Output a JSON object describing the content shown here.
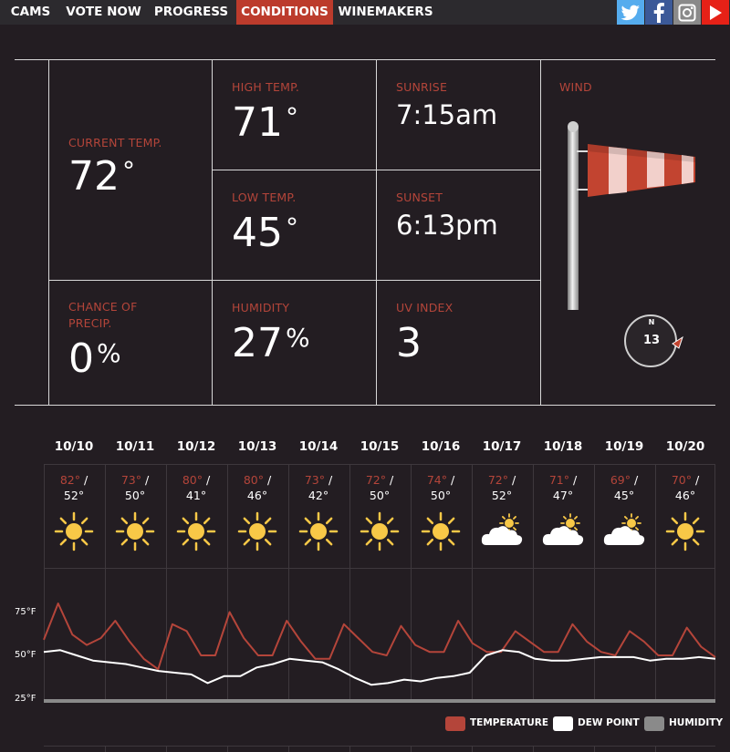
{
  "nav": {
    "items": [
      "CAMS",
      "VOTE NOW",
      "PROGRESS",
      "CONDITIONS",
      "WINEMAKERS"
    ],
    "active": "CONDITIONS",
    "social_icons": [
      "twitter-icon",
      "facebook-icon",
      "instagram-icon",
      "youtube-icon"
    ],
    "social_colors": [
      "#55acee",
      "#3b5998",
      "#8a8a8a",
      "#e62117"
    ]
  },
  "conditions": {
    "current_temp": {
      "label": "CURRENT TEMP.",
      "value": "72",
      "unit": "°"
    },
    "high_temp": {
      "label": "HIGH TEMP.",
      "value": "71",
      "unit": "°"
    },
    "low_temp": {
      "label": "LOW TEMP.",
      "value": "45",
      "unit": "°"
    },
    "sunrise": {
      "label": "SUNRISE",
      "value": "7:15am"
    },
    "sunset": {
      "label": "SUNSET",
      "value": "6:13pm"
    },
    "precip": {
      "label": "CHANCE OF PRECIP.",
      "value": "0",
      "unit": "%"
    },
    "humidity": {
      "label": "HUMIDITY",
      "value": "27",
      "unit": "%"
    },
    "uv_index": {
      "label": "UV INDEX",
      "value": "3"
    },
    "wind": {
      "label": "WIND",
      "speed": "13",
      "direction_label": "N"
    }
  },
  "forecast": [
    {
      "date": "10/10",
      "high": "82°",
      "low": "52°",
      "icon": "sun-icon"
    },
    {
      "date": "10/11",
      "high": "73°",
      "low": "50°",
      "icon": "sun-icon"
    },
    {
      "date": "10/12",
      "high": "80°",
      "low": "41°",
      "icon": "sun-icon"
    },
    {
      "date": "10/13",
      "high": "80°",
      "low": "46°",
      "icon": "sun-icon"
    },
    {
      "date": "10/14",
      "high": "73°",
      "low": "42°",
      "icon": "sun-icon"
    },
    {
      "date": "10/15",
      "high": "72°",
      "low": "50°",
      "icon": "sun-icon"
    },
    {
      "date": "10/16",
      "high": "74°",
      "low": "50°",
      "icon": "sun-icon"
    },
    {
      "date": "10/17",
      "high": "72°",
      "low": "52°",
      "icon": "partly-cloudy-icon"
    },
    {
      "date": "10/18",
      "high": "71°",
      "low": "47°",
      "icon": "partly-cloudy-icon"
    },
    {
      "date": "10/19",
      "high": "69°",
      "low": "45°",
      "icon": "partly-cloudy-icon"
    },
    {
      "date": "10/20",
      "high": "70°",
      "low": "46°",
      "icon": "sun-icon"
    }
  ],
  "chart_data": {
    "type": "line",
    "title": "",
    "xlabel": "",
    "ylabel": "",
    "y_ticks": [
      "75°F",
      "50°F",
      "25°F"
    ],
    "ylim": [
      25,
      85
    ],
    "x_categories": [
      "10/10",
      "10/11",
      "10/12",
      "10/13",
      "10/14",
      "10/15",
      "10/16",
      "10/17",
      "10/18",
      "10/19",
      "10/20"
    ],
    "points_per_day": 4,
    "series": [
      {
        "name": "TEMPERATURE",
        "color": "#b4453a",
        "values": [
          59,
          80,
          62,
          56,
          60,
          70,
          58,
          48,
          42,
          68,
          64,
          50,
          50,
          75,
          60,
          50,
          50,
          70,
          58,
          48,
          48,
          68,
          60,
          52,
          50,
          67,
          56,
          52,
          52,
          70,
          57,
          52,
          52,
          64,
          58,
          52,
          52,
          68,
          58,
          52,
          50,
          64,
          58,
          50,
          50,
          66,
          55,
          49
        ]
      },
      {
        "name": "DEW POINT",
        "color": "#ffffff",
        "values": [
          52,
          53,
          50,
          47,
          46,
          45,
          43,
          41,
          40,
          39,
          34,
          38,
          38,
          43,
          45,
          48,
          47,
          46,
          42,
          37,
          33,
          34,
          36,
          35,
          37,
          38,
          40,
          50,
          53,
          52,
          48,
          47,
          47,
          48,
          49,
          49,
          49,
          47,
          48,
          48,
          49,
          48
        ]
      },
      {
        "name": "HUMIDITY",
        "color": "#8a8a8a",
        "values": []
      }
    ],
    "legend_position": "bottom-right"
  }
}
